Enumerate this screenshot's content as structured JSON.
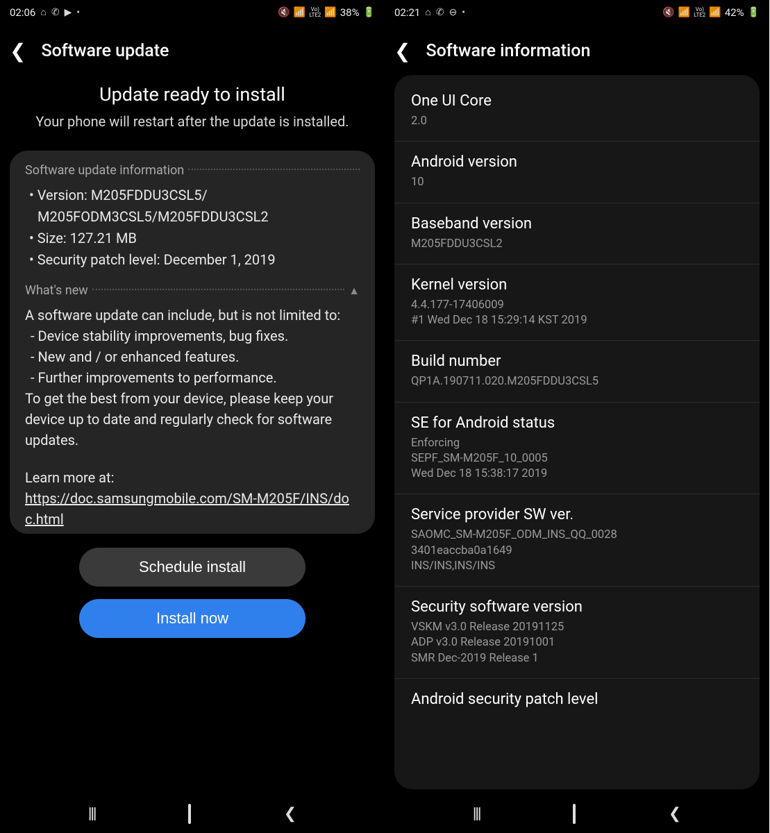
{
  "left": {
    "status": {
      "time": "02:06",
      "icons_left": [
        "bag-icon",
        "whatsapp-icon",
        "play-icon",
        "dot-icon"
      ],
      "battery_text": "38%",
      "lte_top": "Vo)",
      "lte_bot": "LTE2"
    },
    "header_title": "Software update",
    "intro": {
      "title": "Update ready to install",
      "subtitle": "Your phone will restart after the update is installed."
    },
    "sec1_label": "Software update information",
    "bullets": {
      "version_prefix": "• Version: ",
      "version": "M205FDDU3CSL5/ M205FODM3CSL5/M205FDDU3CSL2",
      "size_prefix": "• Size: ",
      "size": "127.21 MB",
      "patch_prefix": "• Security patch level: ",
      "patch": "December 1, 2019"
    },
    "sec2_label": "What's new",
    "whatsnew": {
      "intro": "A software update can include, but is not limited to:",
      "l1": " - Device stability improvements, bug fixes.",
      "l2": " - New and / or enhanced features.",
      "l3": " - Further improvements to performance.",
      "outro": "To get the best from your device, please keep your device up to date and regularly check for software updates.",
      "learn_label": "Learn more at:",
      "learn_url": "https://doc.samsungmobile.com/SM-M205F/INS/doc.html"
    },
    "btn_schedule": "Schedule install",
    "btn_install": "Install now"
  },
  "right": {
    "status": {
      "time": "02:21",
      "icons_left": [
        "bag-icon",
        "whatsapp-icon",
        "minus-circle-icon",
        "dot-icon"
      ],
      "battery_text": "42%",
      "lte_top": "Vo)",
      "lte_bot": "LTE2"
    },
    "header_title": "Software information",
    "items": [
      {
        "label": "One UI Core",
        "value": "2.0"
      },
      {
        "label": "Android version",
        "value": "10"
      },
      {
        "label": "Baseband version",
        "value": "M205FDDU3CSL2"
      },
      {
        "label": "Kernel version",
        "value": "4.4.177-17406009\n#1 Wed Dec 18 15:29:14 KST 2019"
      },
      {
        "label": "Build number",
        "value": "QP1A.190711.020.M205FDDU3CSL5"
      },
      {
        "label": "SE for Android status",
        "value": "Enforcing\nSEPF_SM-M205F_10_0005\nWed Dec 18 15:38:17 2019"
      },
      {
        "label": "Service provider SW ver.",
        "value": "SAOMC_SM-M205F_ODM_INS_QQ_0028\n3401eaccba0a1649\nINS/INS,INS/INS"
      },
      {
        "label": "Security software version",
        "value": "VSKM v3.0 Release 20191125\nADP v3.0 Release 20191001\nSMR Dec-2019 Release 1"
      },
      {
        "label": "Android security patch level",
        "value": ""
      }
    ]
  }
}
